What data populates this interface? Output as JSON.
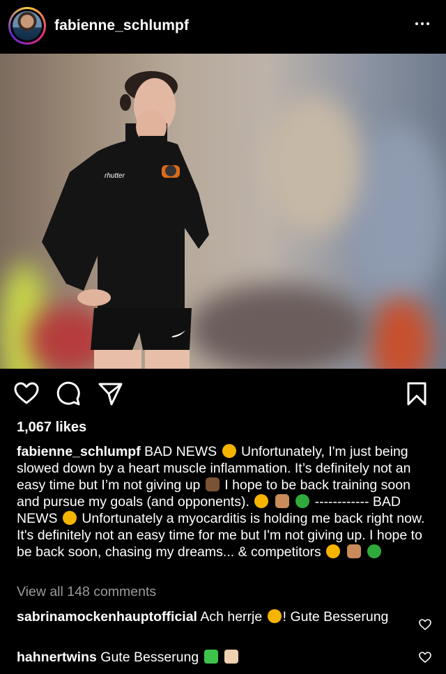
{
  "post": {
    "username": "fabienne_schlumpf",
    "likes": "1,067 likes",
    "caption": {
      "author": "fabienne_schlumpf",
      "part1": "BAD NEWS",
      "part2": "Unfortunately, I'm just being slowed down by a heart muscle inflammation. It’s definitely not an easy time but I’m not giving up",
      "part3": "I hope to be back training soon and pursue my goals (and opponents).",
      "part4": "------------ BAD NEWS",
      "part5": "Unfortunately a myocarditis is holding me back right now. It's definitely not an easy time for me but I'm not giving up. I hope to be back soon, chasing my dreams... & competitors"
    },
    "view_all": "View all 148 comments"
  },
  "comments": [
    {
      "user": "sabrinamockenhauptofficial",
      "text1": "Ach herrje",
      "text2": "! Gute Besserung"
    },
    {
      "user": "hahnertwins",
      "text1": "Gute Besserung",
      "text2": ""
    }
  ],
  "icons": {
    "like": "heart-icon",
    "comment": "comment-icon",
    "share": "send-icon",
    "save": "bookmark-icon",
    "more": "more-options-icon"
  },
  "colors": {
    "background": "#000000",
    "text": "#ffffff",
    "muted": "#9a9a9a"
  }
}
